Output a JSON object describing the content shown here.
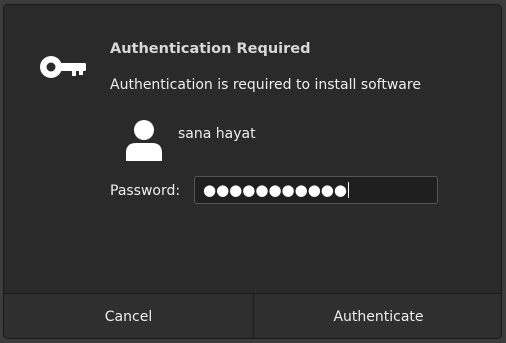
{
  "background": {
    "lines": [
      "",
      "",
      "",
      ""
    ]
  },
  "dialog": {
    "title": "Authentication Required",
    "message": "Authentication is required to install software",
    "user": {
      "name": "sana hayat"
    },
    "password": {
      "label": "Password:",
      "value": "●●●●●●●●●●●"
    },
    "buttons": {
      "cancel": "Cancel",
      "authenticate": "Authenticate"
    }
  },
  "icons": {
    "app": "key-icon",
    "user": "user-avatar-icon"
  },
  "colors": {
    "dialog_bg": "#2a2a2a",
    "text": "#eeeeee",
    "button_bg": "#2f2f2f"
  }
}
